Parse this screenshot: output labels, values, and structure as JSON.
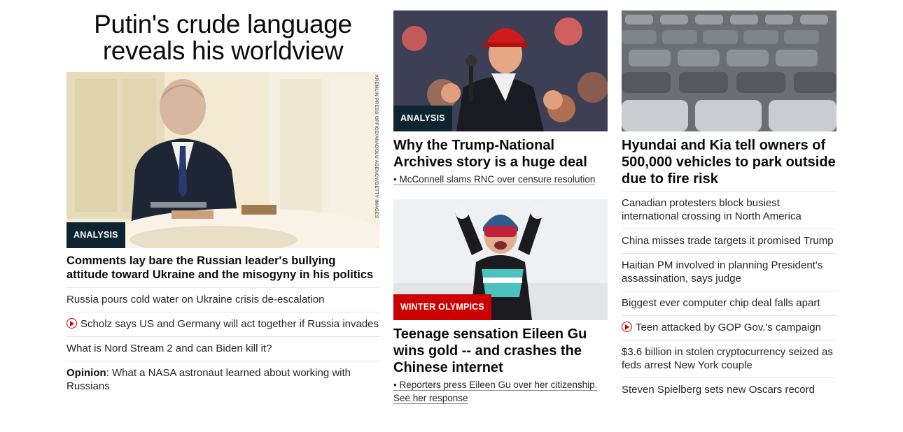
{
  "col1": {
    "headline": "Putin's crude language reveals his worldview",
    "photo_credit": "KREMLIN PRESS OFFICE/ANADOLU AGENCY/GETTY IMAGES",
    "badge": "ANALYSIS",
    "lead": "Comments lay bare the Russian leader's bullying attitude toward Ukraine and the misogyny in his politics",
    "items": [
      {
        "text": "Russia pours cold water on Ukraine crisis de-escalation"
      },
      {
        "text": "Scholz says US and Germany will act together if Russia invades",
        "video": true
      },
      {
        "text": "What is Nord Stream 2 and can Biden kill it?"
      },
      {
        "prefix": "Opinion",
        "text": ": What a NASA astronaut learned about working with Russians"
      }
    ]
  },
  "col2": {
    "story1": {
      "badge": "ANALYSIS",
      "title": "Why the Trump-National Archives story is a huge deal",
      "sub": "• McConnell slams RNC over censure resolution"
    },
    "story2": {
      "badge": "WINTER OLYMPICS",
      "title": "Teenage sensation Eileen Gu wins gold -- and crashes the Chinese internet",
      "sub": "• Reporters press Eileen Gu over her citizenship. See her response"
    }
  },
  "col3": {
    "title": "Hyundai and Kia tell owners of 500,000 vehicles to park outside due to fire risk",
    "items": [
      {
        "text": "Canadian protesters block busiest international crossing in North America"
      },
      {
        "text": "China misses trade targets it promised Trump"
      },
      {
        "text": "Haitian PM involved in planning President's assassination, says judge"
      },
      {
        "text": "Biggest ever computer chip deal falls apart"
      },
      {
        "text": "Teen attacked by GOP Gov.'s campaign",
        "video": true
      },
      {
        "text": "$3.6 billion in stolen cryptocurrency seized as feds arrest New York couple"
      },
      {
        "text": "Steven Spielberg sets new Oscars record"
      }
    ]
  },
  "colors": {
    "badge_dark": "#0c2531",
    "badge_red": "#cc0000",
    "video_icon": "#cc0000"
  }
}
